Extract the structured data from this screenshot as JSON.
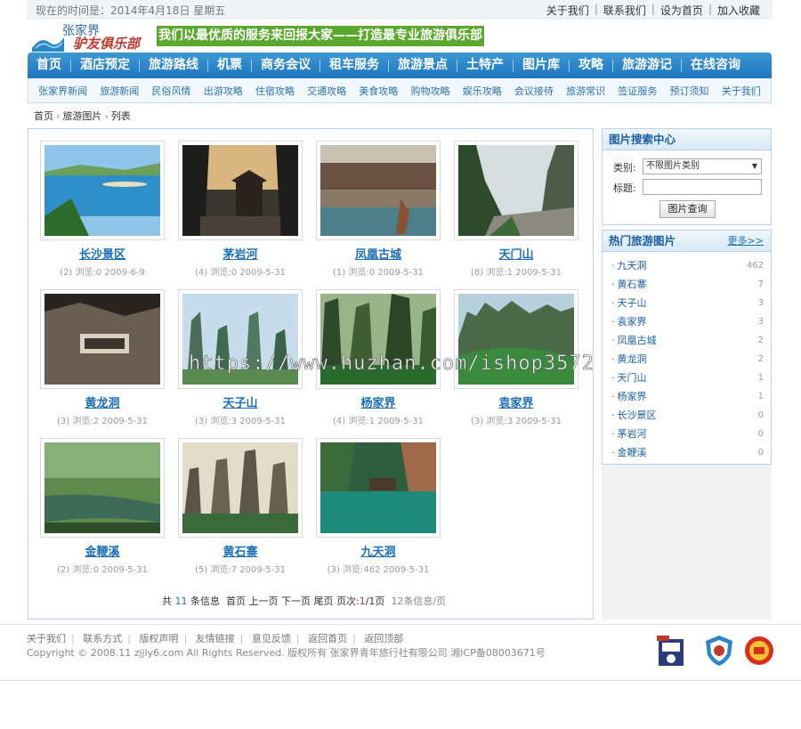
{
  "topbar": {
    "date": "现在的时间是：2014年4月18日 星期五",
    "links": [
      "关于我们",
      "联系我们",
      "设为首页",
      "加入收藏"
    ]
  },
  "logo": {
    "line1": "张家界",
    "line2": "驴友俱乐部"
  },
  "slogan": "我们以最优质的服务来回报大家——打造最专业旅游俱乐部",
  "main_nav": [
    "首页",
    "酒店预定",
    "旅游路线",
    "机票",
    "商务会议",
    "租车服务",
    "旅游景点",
    "土特产",
    "图片库",
    "攻略",
    "旅游游记",
    "在线咨询"
  ],
  "sub_nav": [
    "张家界新闻",
    "旅游新闻",
    "民俗风情",
    "出游攻略",
    "住宿攻略",
    "交通攻略",
    "美食攻略",
    "购物攻略",
    "娱乐攻略",
    "会议接待",
    "旅游常识",
    "签证服务",
    "预订须知",
    "关于我们"
  ],
  "breadcrumb": [
    "首页",
    "旅游图片",
    "列表"
  ],
  "photos": [
    {
      "name": "长沙景区",
      "meta": "(2) 浏览:0  2009-6-9"
    },
    {
      "name": "茅岩河",
      "meta": "(4) 浏览:0  2009-5-31"
    },
    {
      "name": "凤凰古城",
      "meta": "(1) 浏览:0  2009-5-31"
    },
    {
      "name": "天门山",
      "meta": "(8) 浏览:1  2009-5-31"
    },
    {
      "name": "黄龙洞",
      "meta": "(3) 浏览:2  2009-5-31"
    },
    {
      "name": "天子山",
      "meta": "(3) 浏览:3  2009-5-31"
    },
    {
      "name": "杨家界",
      "meta": "(4) 浏览:1  2009-5-31"
    },
    {
      "name": "袁家界",
      "meta": "(3) 浏览:3  2009-5-31"
    },
    {
      "name": "金鞭溪",
      "meta": "(2) 浏览:0  2009-5-31"
    },
    {
      "name": "黄石寨",
      "meta": "(5) 浏览:7  2009-5-31"
    },
    {
      "name": "九天洞",
      "meta": "(3) 浏览:462  2009-5-31"
    }
  ],
  "pager": {
    "total_prefix": "共",
    "total": "11",
    "total_suffix": "条信息",
    "first": "首页",
    "prev": "上一页",
    "next": "下一页",
    "last": "尾页",
    "page_label": "页次:",
    "current": "1",
    "pages": "/1页",
    "per_page": "12条信息/页"
  },
  "search": {
    "title": "图片搜索中心",
    "category_label": "类别:",
    "category_value": "不限图片类别",
    "title_label": "标题:",
    "title_value": "",
    "button": "图片查询"
  },
  "hot": {
    "title": "热门旅游图片",
    "more": "更多>>",
    "items": [
      {
        "name": "九天洞",
        "count": "462"
      },
      {
        "name": "黄石寨",
        "count": "7"
      },
      {
        "name": "天子山",
        "count": "3"
      },
      {
        "name": "袁家界",
        "count": "3"
      },
      {
        "name": "凤凰古城",
        "count": "2"
      },
      {
        "name": "黄龙洞",
        "count": "2"
      },
      {
        "name": "天门山",
        "count": "1"
      },
      {
        "name": "杨家界",
        "count": "1"
      },
      {
        "name": "长沙景区",
        "count": "0"
      },
      {
        "name": "茅岩河",
        "count": "0"
      },
      {
        "name": "金鞭溪",
        "count": "0"
      }
    ]
  },
  "footer": {
    "links": [
      "关于我们",
      "联系方式",
      "版权声明",
      "友情链接",
      "意见反馈",
      "返回首页",
      "返回顶部"
    ],
    "copyright": "Copyright © 2008.11 zjjly6.com All Rights Reserved.  版权所有 张家界青年旅行社有限公司  湘ICP备08003671号"
  },
  "watermark": "https://www.huzhan.com/ishop3572",
  "colors": {
    "nav_blue": "#1f76be",
    "link_blue": "#1c6fb5",
    "slogan_green": "#5aa82d"
  }
}
